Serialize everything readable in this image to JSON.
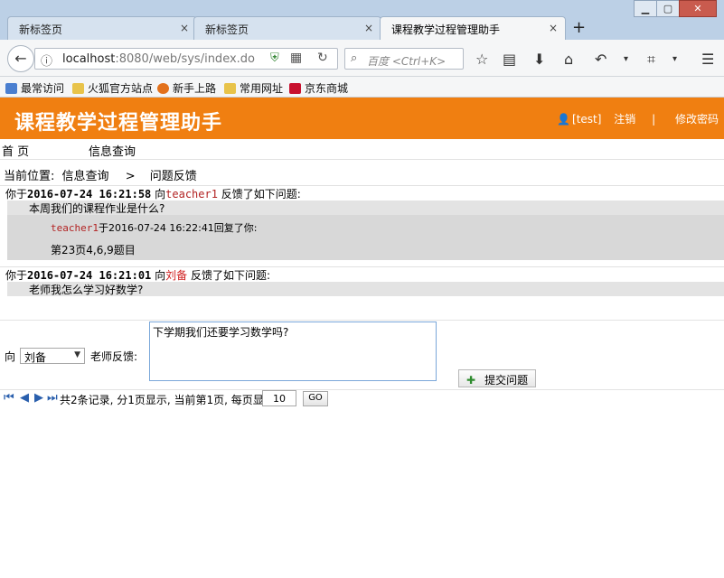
{
  "browser": {
    "tabs": [
      {
        "label": "新标签页"
      },
      {
        "label": "新标签页"
      },
      {
        "label": "课程教学过程管理助手"
      }
    ],
    "new_tab": "+",
    "close_glyph": "×",
    "url_host": "localhost",
    "url_rest": ":8080/web/sys/index.do",
    "search_placeholder": "百度 <Ctrl+K>",
    "bookmarks": [
      "最常访问",
      "火狐官方站点",
      "新手上路",
      "常用网址",
      "京东商城"
    ]
  },
  "app": {
    "title": "课程教学过程管理助手",
    "user": "[test]",
    "logout": "注销",
    "separator": "|",
    "change_password": "修改密码",
    "accent_color": "#f07f11"
  },
  "menu": [
    "首  页",
    "信息查询"
  ],
  "breadcrumb": {
    "prefix": "当前位置:",
    "item1": "信息查询",
    "sep": ">",
    "item2": "问题反馈"
  },
  "messages": [
    {
      "prefix": "你于",
      "timestamp": "2016-07-24 16:21:58",
      "to": "向",
      "recipient": "teacher1",
      "suffix": "反馈了如下问题:",
      "question": "本周我们的课程作业是什么?",
      "reply": {
        "who": "teacher1",
        "mid": "于2016-07-24 16:22:41回复了你:",
        "text": "第23页4,6,9题目"
      }
    },
    {
      "prefix": "你于",
      "timestamp": "2016-07-24 16:21:01",
      "to": "向",
      "recipient": "刘备",
      "suffix": "反馈了如下问题:",
      "question": "老师我怎么学习好数学?"
    }
  ],
  "form": {
    "to_label": "向",
    "selected_teacher": "刘备",
    "feedback_label": "老师反馈:",
    "textarea_value": "下学期我们还要学习数学吗?",
    "submit_label": "提交问题"
  },
  "pager": {
    "summary": "共2条记录, 分1页显示, 当前第1页, 每页显示",
    "page_size": "10",
    "go_label": "GO"
  }
}
